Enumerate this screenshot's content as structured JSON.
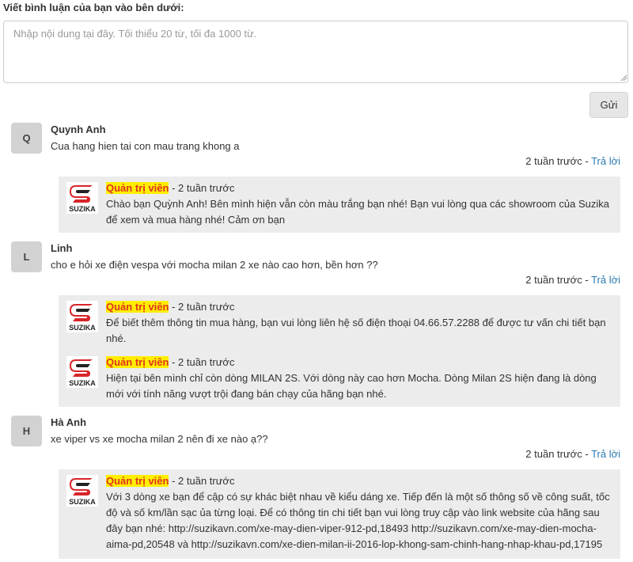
{
  "form": {
    "title": "Viết bình luận của bạn vào bên dưới:",
    "placeholder": "Nhập nội dung tại đây. Tối thiểu 20 từ, tối đa 1000 từ.",
    "send_label": "Gửi"
  },
  "comments": [
    {
      "initial": "Q",
      "name": "Quynh Anh",
      "text": "Cua hang hien tai con mau trang khong a",
      "time": "2 tuần trước",
      "reply_label": "Trả lời",
      "replies": [
        {
          "author": "Quản trị viên",
          "time": "- 2 tuần trước",
          "text": "Chào bạn Quỳnh Anh! Bên mình hiện vẫn còn màu trắng bạn nhé! Bạn vui lòng qua các showroom của Suzika để xem và mua hàng nhé! Cảm ơn bạn"
        }
      ]
    },
    {
      "initial": "L",
      "name": "Linh",
      "text": "cho e hỏi xe điện vespa với mocha milan 2 xe nào cao hơn, bền hơn ??",
      "time": "2 tuần trước",
      "reply_label": "Trả lời",
      "replies": [
        {
          "author": "Quản trị viên",
          "time": "- 2 tuần trước",
          "text": "Để biết thêm thông tin mua hàng, bạn vui lòng liên hệ số điện thoại 04.66.57.2288 để được tư vấn chi tiết bạn nhé."
        },
        {
          "author": "Quản trị viên",
          "time": "- 2 tuần trước",
          "text": "Hiện tại bên mình chỉ còn dòng MILAN 2S. Với dòng này cao hơn Mocha. Dòng Milan 2S hiện đang là dòng mới với tính năng vượt trội đang bán chạy của hãng bạn nhé."
        }
      ]
    },
    {
      "initial": "H",
      "name": "Hà Anh",
      "text": "xe viper vs xe mocha milan 2 nên đi xe nào ạ??",
      "time": "2 tuần trước",
      "reply_label": "Trả lời",
      "replies": [
        {
          "author": "Quản trị viên",
          "time": "- 2 tuần trước",
          "text": "Với 3 dòng xe bạn để cập có sự khác biệt nhau về kiểu dáng xe. Tiếp đến là một số thông số về công suất, tốc độ và số km/lần sạc ủa từng loại. Để có thông tin chi tiết bạn vui lòng truy cập vào link website của hãng sau đây bạn nhé: http://suzikavn.com/xe-may-dien-viper-912-pd,18493 http://suzikavn.com/xe-may-dien-mocha-aima-pd,20548 và http://suzikavn.com/xe-dien-milan-ii-2016-lop-khong-sam-chinh-hang-nhap-khau-pd,17195"
        }
      ]
    }
  ],
  "logo_text": "SUZIKA",
  "colors": {
    "admin_badge_bg": "#ffee00",
    "admin_badge_text": "#e0341e",
    "link": "#2a7ab0",
    "reply_bg": "#ececec",
    "logo_red": "#d8252a"
  }
}
